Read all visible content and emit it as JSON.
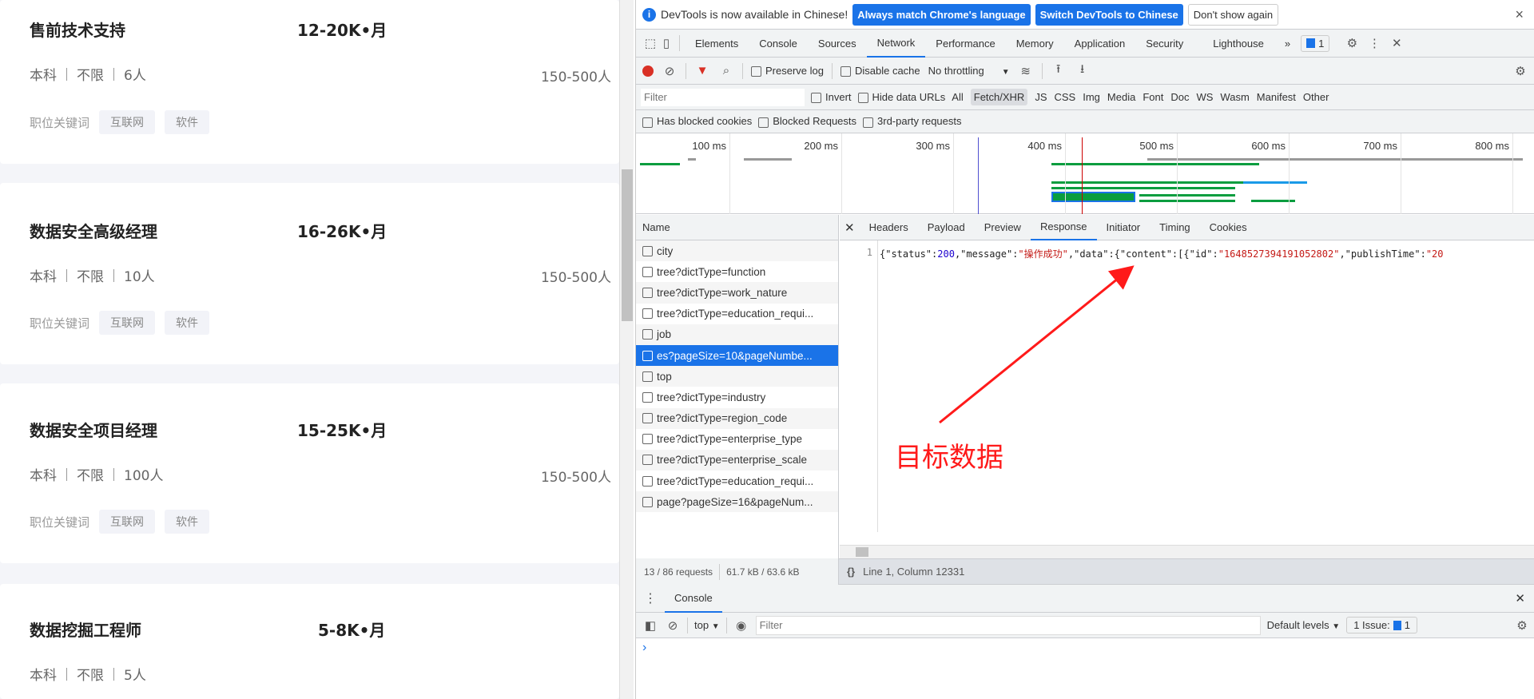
{
  "jobs": [
    {
      "title": "售前技术支持",
      "salary": "12-20K•月",
      "education": "本科",
      "experience": "不限",
      "headcount": "6人",
      "company_scale": "150-500人",
      "keyword_label": "职位关键词",
      "tags": [
        "互联网",
        "软件"
      ]
    },
    {
      "title": "数据安全高级经理",
      "salary": "16-26K•月",
      "education": "本科",
      "experience": "不限",
      "headcount": "10人",
      "company_scale": "150-500人",
      "keyword_label": "职位关键词",
      "tags": [
        "互联网",
        "软件"
      ]
    },
    {
      "title": "数据安全项目经理",
      "salary": "15-25K•月",
      "education": "本科",
      "experience": "不限",
      "headcount": "100人",
      "company_scale": "150-500人",
      "keyword_label": "职位关键词",
      "tags": [
        "互联网",
        "软件"
      ]
    },
    {
      "title": "数据挖掘工程师",
      "salary": "5-8K•月",
      "education": "本科",
      "experience": "不限",
      "headcount": "5人"
    }
  ],
  "devtools": {
    "banner": {
      "message": "DevTools is now available in Chinese!",
      "btn1": "Always match Chrome's language",
      "btn2": "Switch DevTools to Chinese",
      "btn3": "Don't show again",
      "close": "×"
    },
    "tabs": [
      "Elements",
      "Console",
      "Sources",
      "Network",
      "Performance",
      "Memory",
      "Application",
      "Security",
      "Lighthouse"
    ],
    "active_tab": "Network",
    "more": "»",
    "issues_badge": "1",
    "toolbar": {
      "preserve_log": "Preserve log",
      "disable_cache": "Disable cache",
      "throttling": "No throttling"
    },
    "filter": {
      "placeholder": "Filter",
      "invert": "Invert",
      "hide_data_urls": "Hide data URLs",
      "types": [
        "All",
        "Fetch/XHR",
        "JS",
        "CSS",
        "Img",
        "Media",
        "Font",
        "Doc",
        "WS",
        "Wasm",
        "Manifest",
        "Other"
      ],
      "active_type": "Fetch/XHR"
    },
    "checks": [
      "Has blocked cookies",
      "Blocked Requests",
      "3rd-party requests"
    ],
    "timeline_ticks": [
      "100 ms",
      "200 ms",
      "300 ms",
      "400 ms",
      "500 ms",
      "600 ms",
      "700 ms",
      "800 ms"
    ],
    "name_header": "Name",
    "requests": [
      "city",
      "tree?dictType=function",
      "tree?dictType=work_nature",
      "tree?dictType=education_requi...",
      "job",
      "es?pageSize=10&pageNumbe...",
      "top",
      "tree?dictType=industry",
      "tree?dictType=region_code",
      "tree?dictType=enterprise_type",
      "tree?dictType=enterprise_scale",
      "tree?dictType=education_requi...",
      "page?pageSize=16&pageNum..."
    ],
    "selected_request": "es?pageSize=10&pageNumbe...",
    "detail_tabs": [
      "Headers",
      "Payload",
      "Preview",
      "Response",
      "Initiator",
      "Timing",
      "Cookies"
    ],
    "active_detail_tab": "Response",
    "response": {
      "line_no": "1",
      "p1": "{\"status\":",
      "p2": "200",
      "p3": ",\"message\":",
      "p4": "\"操作成功\"",
      "p5": ",\"data\":{\"content\":[{\"id\":",
      "p6": "\"1648527394191052802\"",
      "p7": ",\"publishTime\":",
      "p8": "\"20"
    },
    "status": {
      "requests": "13 / 86 requests",
      "transferred": "61.7 kB / 63.6 kB",
      "cursor": "Line 1, Column 12331"
    },
    "drawer": {
      "tab": "Console",
      "context": "top",
      "filter_placeholder": "Filter",
      "levels": "Default levels",
      "issues": "1 Issue:",
      "issues_count": "1",
      "prompt": "›"
    }
  },
  "annotation": {
    "text": "目标数据",
    "color": "#ff1a1a"
  },
  "colors": {
    "accent": "#1a73e8",
    "record": "#d93025"
  }
}
